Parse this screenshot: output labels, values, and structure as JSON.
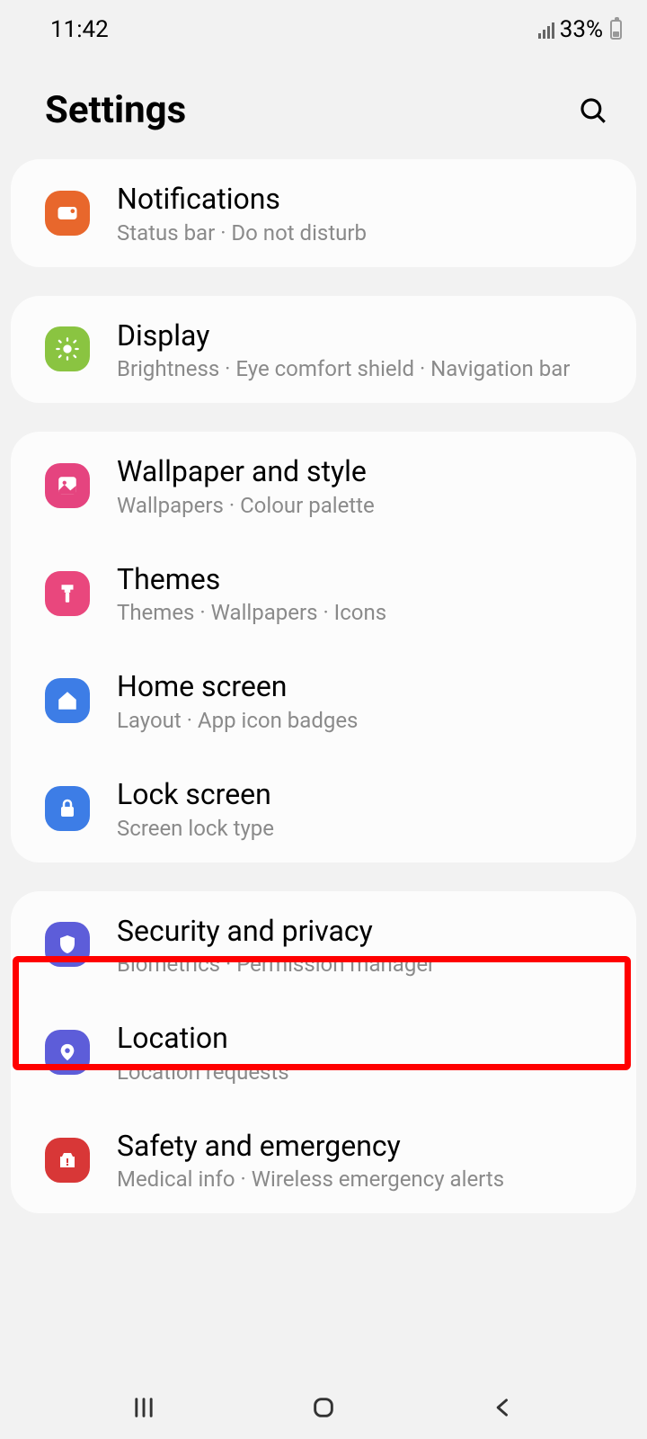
{
  "statusBar": {
    "time": "11:42",
    "battery": "33%"
  },
  "header": {
    "title": "Settings"
  },
  "groups": [
    {
      "items": [
        {
          "id": "notifications",
          "title": "Notifications",
          "subtitle": "Status bar  ·  Do not disturb",
          "iconColor": "icon-orange",
          "iconName": "notifications-icon"
        }
      ]
    },
    {
      "items": [
        {
          "id": "display",
          "title": "Display",
          "subtitle": "Brightness  ·  Eye comfort shield  ·  Navigation bar",
          "iconColor": "icon-green",
          "iconName": "display-icon"
        }
      ]
    },
    {
      "items": [
        {
          "id": "wallpaper",
          "title": "Wallpaper and style",
          "subtitle": "Wallpapers  ·  Colour palette",
          "iconColor": "icon-pink",
          "iconName": "wallpaper-icon"
        },
        {
          "id": "themes",
          "title": "Themes",
          "subtitle": "Themes  ·  Wallpapers  ·  Icons",
          "iconColor": "icon-pink2",
          "iconName": "themes-icon"
        },
        {
          "id": "homescreen",
          "title": "Home screen",
          "subtitle": "Layout  ·  App icon badges",
          "iconColor": "icon-blue",
          "iconName": "home-icon"
        },
        {
          "id": "lockscreen",
          "title": "Lock screen",
          "subtitle": "Screen lock type",
          "iconColor": "icon-blue2",
          "iconName": "lock-icon"
        }
      ]
    },
    {
      "items": [
        {
          "id": "security",
          "title": "Security and privacy",
          "subtitle": "Biometrics  ·  Permission manager",
          "iconColor": "icon-purple",
          "iconName": "shield-icon",
          "highlighted": true
        },
        {
          "id": "location",
          "title": "Location",
          "subtitle": "Location requests",
          "iconColor": "icon-purple2",
          "iconName": "location-icon"
        },
        {
          "id": "safety",
          "title": "Safety and emergency",
          "subtitle": "Medical info  ·  Wireless emergency alerts",
          "iconColor": "icon-red",
          "iconName": "emergency-icon"
        }
      ]
    }
  ]
}
